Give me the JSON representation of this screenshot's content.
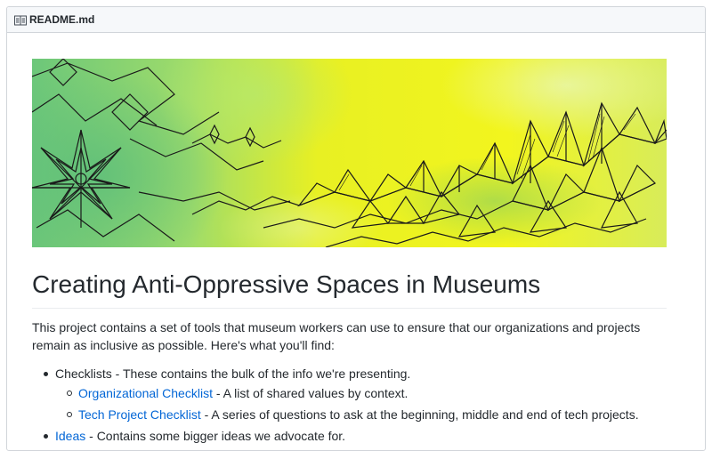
{
  "readme": {
    "icon": "book-icon",
    "filename": "README.md"
  },
  "banner": {
    "description_colors": [
      "#c8e84a",
      "#7cc96a",
      "#f0f21a",
      "#1a1a1a"
    ]
  },
  "content": {
    "title": "Creating Anti-Oppressive Spaces in Museums",
    "intro": "This project contains a set of tools that museum workers can use to ensure that our organizations and projects remain as inclusive as possible. Here's what you'll find:",
    "items": [
      {
        "label": "Checklists",
        "text": " - These contains the bulk of the info we're presenting.",
        "children": [
          {
            "link": "Organizational Checklist",
            "text": " - A list of shared values by context."
          },
          {
            "link": "Tech Project Checklist",
            "text": " - A series of questions to ask at the beginning, middle and end of tech projects."
          }
        ]
      },
      {
        "link": "Ideas",
        "text": " - Contains some bigger ideas we advocate for."
      }
    ]
  },
  "colors": {
    "link": "#0366d6",
    "text": "#24292e",
    "header_bg": "#f6f8fa",
    "border": "#d1d5da"
  }
}
